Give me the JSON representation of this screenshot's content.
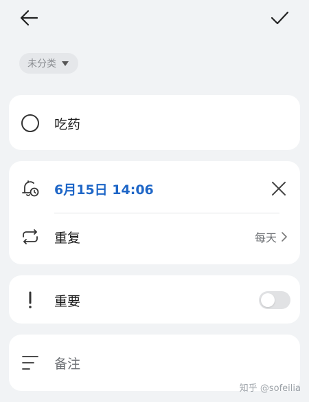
{
  "category": {
    "label": "未分类",
    "icon": "caret-down-icon"
  },
  "task": {
    "title": "吃药",
    "checkbox_icon": "circle-checkbox-icon"
  },
  "reminder": {
    "datetime": "6月15日 14:06",
    "icon": "bell-clock-icon",
    "close_icon": "close-icon"
  },
  "repeat": {
    "label": "重复",
    "value": "每天",
    "icon": "repeat-icon"
  },
  "important": {
    "label": "重要",
    "icon": "exclamation-icon",
    "toggle_on": false
  },
  "notes": {
    "placeholder": "备注",
    "icon": "notes-lines-icon"
  },
  "watermark": "知乎 @sofeilia",
  "colors": {
    "accent": "#1e66c7",
    "background": "#f1f3f5",
    "card": "#ffffff"
  }
}
